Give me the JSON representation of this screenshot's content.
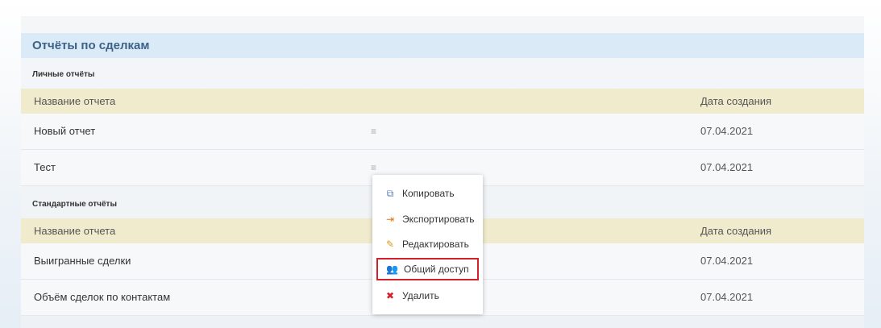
{
  "panel": {
    "title": "Отчёты по сделкам",
    "personal": {
      "section_label": "Личные отчёты",
      "col_name": "Название отчета",
      "col_date": "Дата создания",
      "rows": [
        {
          "name": "Новый отчет",
          "date": "07.04.2021"
        },
        {
          "name": "Тест",
          "date": "07.04.2021"
        }
      ]
    },
    "standard": {
      "section_label": "Стандартные отчёты",
      "col_name": "Название отчета",
      "col_date": "Дата создания",
      "rows": [
        {
          "name": "Выигранные сделки",
          "date": "07.04.2021"
        },
        {
          "name": "Объём сделок по контактам",
          "date": "07.04.2021"
        }
      ]
    },
    "row_menu_icon": "≡"
  },
  "context_menu": {
    "items": [
      {
        "label": "Копировать",
        "icon": "copy-icon",
        "glyph": "⧉",
        "color": "#5b7fb0"
      },
      {
        "label": "Экспортировать",
        "icon": "export-icon",
        "glyph": "⇥",
        "color": "#e07a10"
      },
      {
        "label": "Редактировать",
        "icon": "pencil-icon",
        "glyph": "✎",
        "color": "#d99a1a"
      },
      {
        "label": "Общий доступ",
        "icon": "users-icon",
        "glyph": "👥",
        "color": "#2f6fb0"
      },
      {
        "label": "Удалить",
        "icon": "delete-icon",
        "glyph": "✖",
        "color": "#d4202a"
      }
    ],
    "highlighted_index": 3,
    "highlight_color": "#d4202a"
  }
}
